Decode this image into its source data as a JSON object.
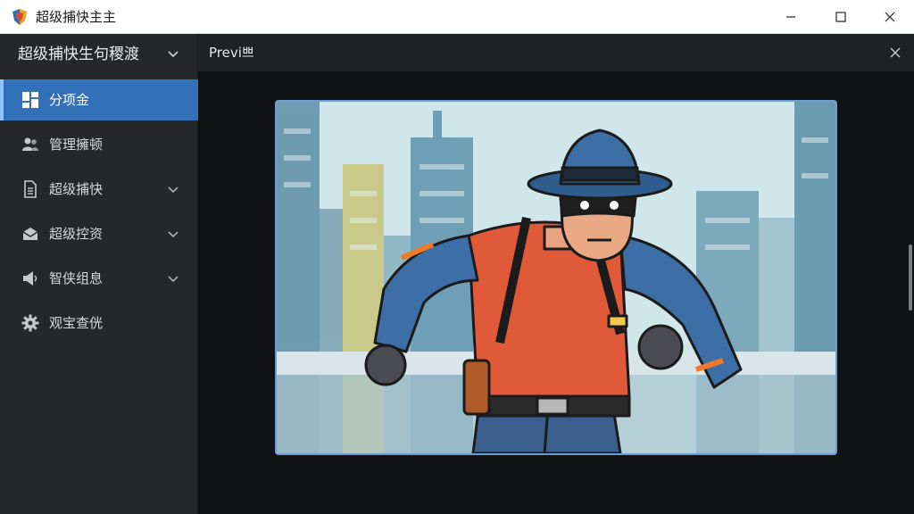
{
  "window": {
    "title": "超级捕快主主",
    "minimize_icon": "minimize-icon",
    "maximize_icon": "maximize-icon",
    "close_icon": "close-icon"
  },
  "sidebar": {
    "title": "超级捕快生句稷渡",
    "items": [
      {
        "label": "分项金",
        "icon": "dashboard-icon",
        "active": true,
        "expandable": false
      },
      {
        "label": "管理擁顿",
        "icon": "users-icon",
        "active": false,
        "expandable": false
      },
      {
        "label": "超级捕快",
        "icon": "document-icon",
        "active": false,
        "expandable": true
      },
      {
        "label": "超级控资",
        "icon": "mail-icon",
        "active": false,
        "expandable": true
      },
      {
        "label": "智侠组息",
        "icon": "megaphone-icon",
        "active": false,
        "expandable": true
      },
      {
        "label": "观宝查侊",
        "icon": "gear-icon",
        "active": false,
        "expandable": false
      }
    ]
  },
  "preview": {
    "title": "Previ쁘",
    "image": "cartoon-detective-running-illustration"
  },
  "colors": {
    "accent": "#3271b8",
    "sidebar_bg": "#25272b",
    "main_bg": "#111214"
  }
}
